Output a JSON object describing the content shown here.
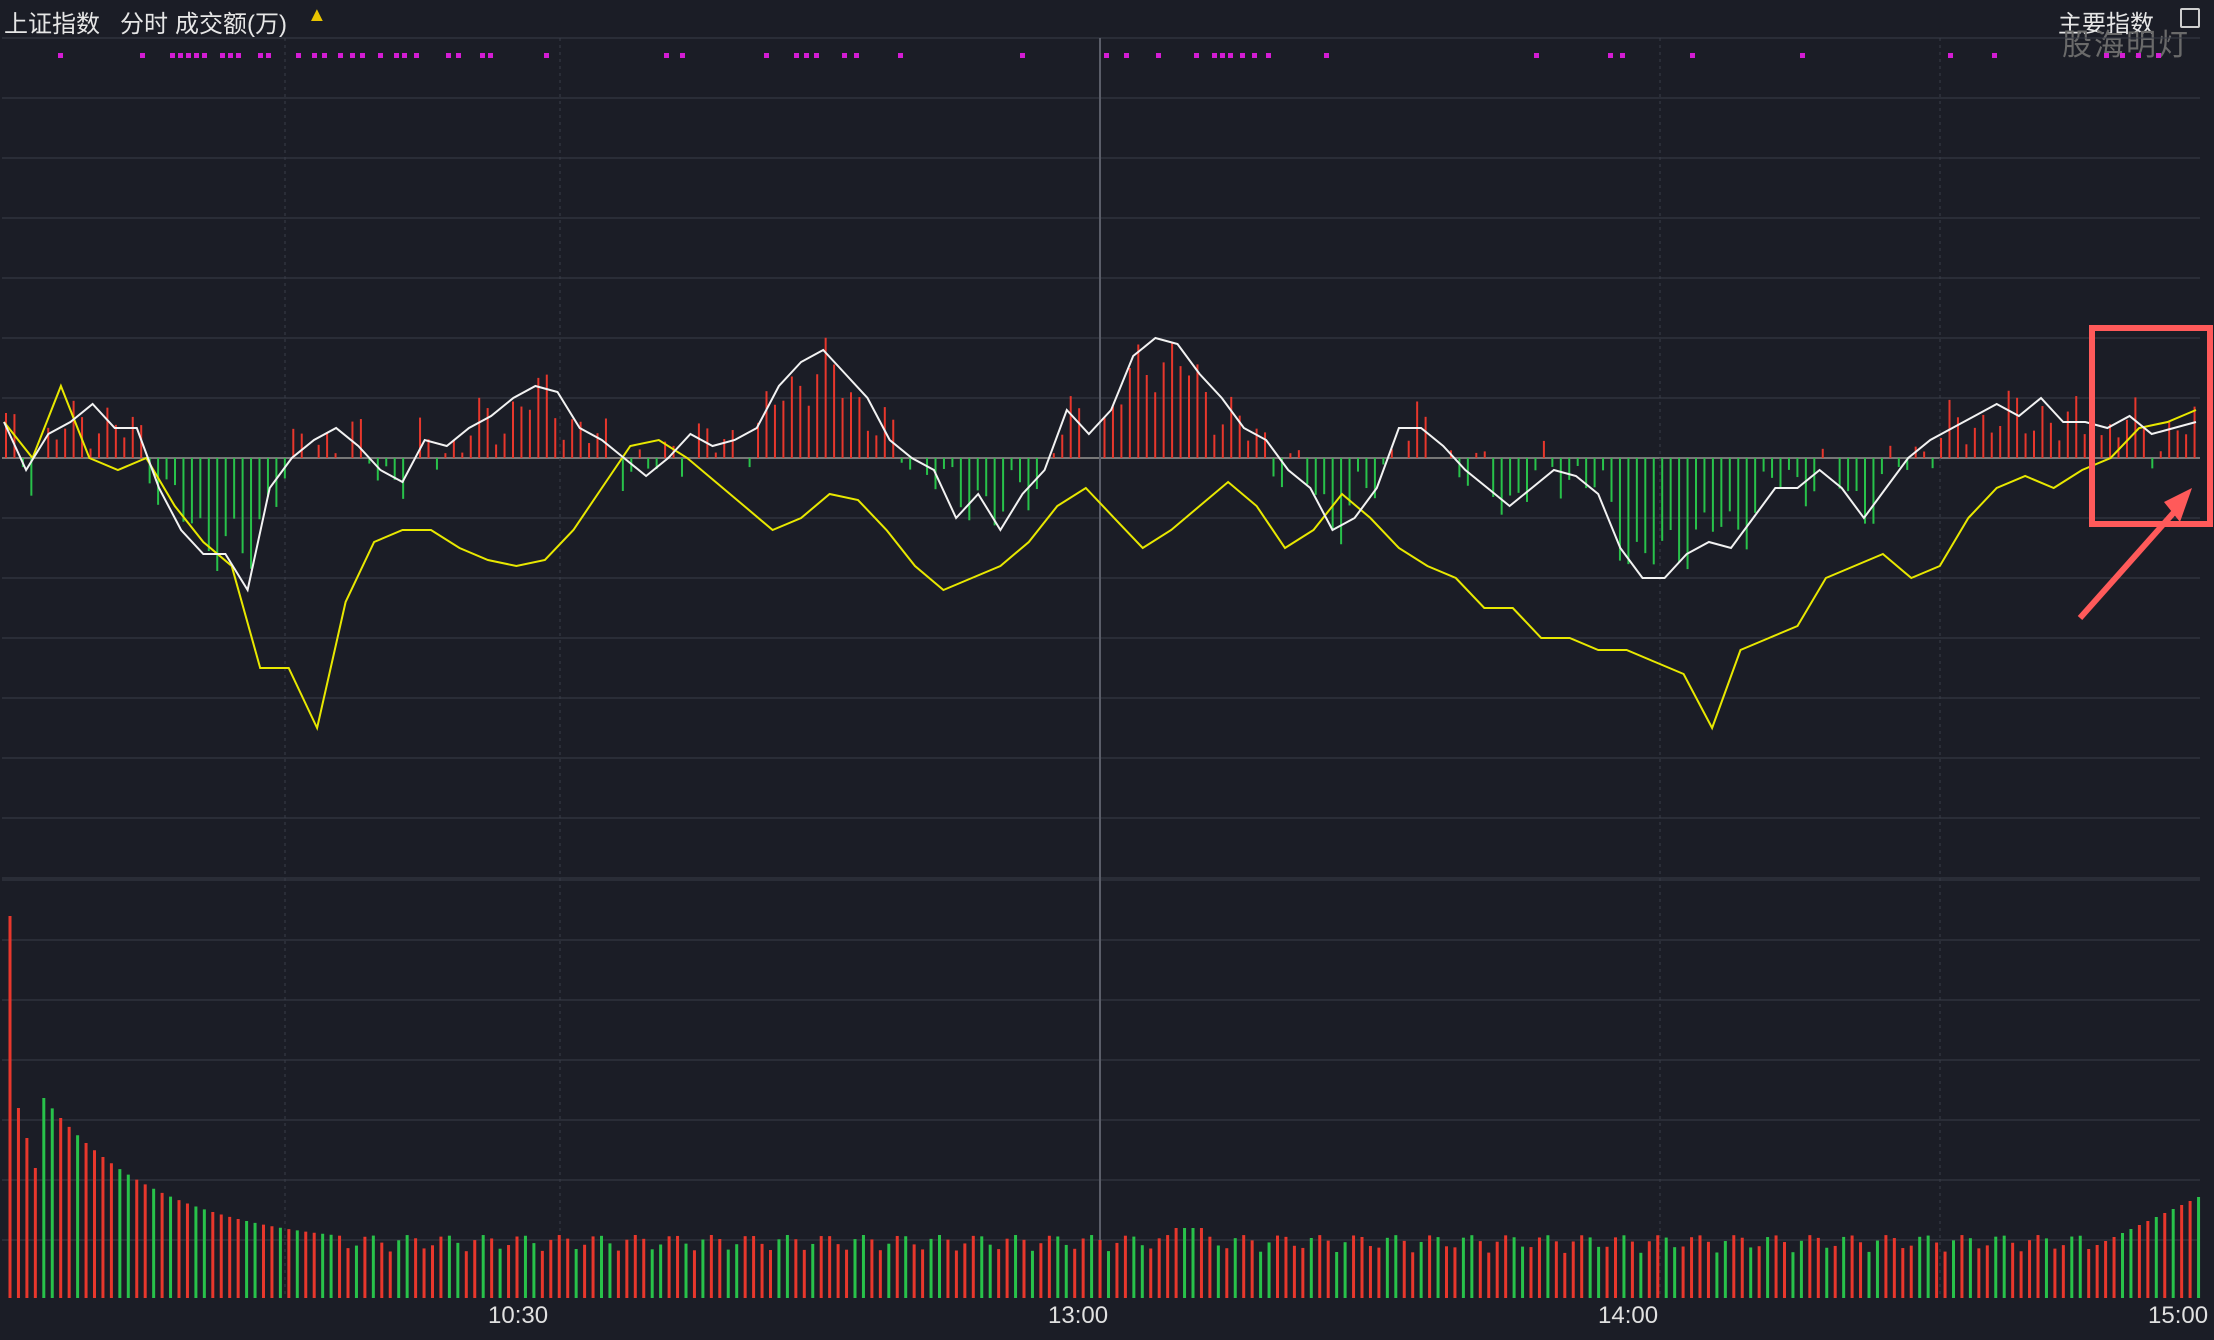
{
  "header": {
    "title": "上证指数",
    "mode": "分时",
    "volume_label": "成交额(万)",
    "toggle_icon": "up-down-arrow-icon",
    "main_index_label": "主要指数",
    "restore_icon": "window-restore-icon",
    "watermark": "股海明灯"
  },
  "colors": {
    "background": "#1b1d26",
    "grid": "#3a3d48",
    "white_line": "#f2f2f2",
    "yellow_line": "#e8e800",
    "up": "#e8372c",
    "down": "#28c24a",
    "dot": "#d41cd4",
    "highlight": "#ff5a5a"
  },
  "chart_data": {
    "type": "line",
    "x_ticks": [
      "10:30",
      "13:00",
      "14:00",
      "15:00"
    ],
    "series": [
      {
        "color": "white",
        "values": [
          0.06,
          -0.02,
          0.04,
          0.06,
          0.09,
          0.05,
          0.05,
          -0.05,
          -0.12,
          -0.16,
          -0.16,
          -0.22,
          -0.05,
          0.0,
          0.03,
          0.05,
          0.02,
          -0.02,
          -0.04,
          0.03,
          0.02,
          0.05,
          0.07,
          0.1,
          0.12,
          0.11,
          0.05,
          0.03,
          0.0,
          -0.03,
          0.0,
          0.04,
          0.02,
          0.03,
          0.05,
          0.12,
          0.16,
          0.18,
          0.14,
          0.1,
          0.03,
          0.0,
          -0.02,
          -0.1,
          -0.06,
          -0.12,
          -0.06,
          -0.02,
          0.08,
          0.04,
          0.08,
          0.17,
          0.2,
          0.19,
          0.14,
          0.1,
          0.05,
          0.03,
          -0.02,
          -0.05,
          -0.12,
          -0.1,
          -0.05,
          0.05,
          0.05,
          0.02,
          -0.02,
          -0.05,
          -0.08,
          -0.05,
          -0.02,
          -0.03,
          -0.06,
          -0.15,
          -0.2,
          -0.2,
          -0.16,
          -0.14,
          -0.15,
          -0.1,
          -0.05,
          -0.05,
          -0.02,
          -0.05,
          -0.1,
          -0.05,
          0.0,
          0.03,
          0.05,
          0.07,
          0.09,
          0.07,
          0.1,
          0.06,
          0.06,
          0.05,
          0.07,
          0.04,
          0.05,
          0.06
        ],
        "note_units": "percent"
      },
      {
        "color": "yellow",
        "values": [
          0.06,
          0.0,
          0.12,
          0.0,
          -0.02,
          0.0,
          -0.08,
          -0.14,
          -0.18,
          -0.35,
          -0.35,
          -0.45,
          -0.24,
          -0.14,
          -0.12,
          -0.12,
          -0.15,
          -0.17,
          -0.18,
          -0.17,
          -0.12,
          -0.05,
          0.02,
          0.03,
          0.0,
          -0.04,
          -0.08,
          -0.12,
          -0.1,
          -0.06,
          -0.07,
          -0.12,
          -0.18,
          -0.22,
          -0.2,
          -0.18,
          -0.14,
          -0.08,
          -0.05,
          -0.1,
          -0.15,
          -0.12,
          -0.08,
          -0.04,
          -0.08,
          -0.15,
          -0.12,
          -0.06,
          -0.1,
          -0.15,
          -0.18,
          -0.2,
          -0.25,
          -0.25,
          -0.3,
          -0.3,
          -0.32,
          -0.32,
          -0.34,
          -0.36,
          -0.45,
          -0.32,
          -0.3,
          -0.28,
          -0.2,
          -0.18,
          -0.16,
          -0.2,
          -0.18,
          -0.1,
          -0.05,
          -0.03,
          -0.05,
          -0.02,
          0.0,
          0.05,
          0.06,
          0.08
        ]
      }
    ],
    "bottom_panel": "volume bars"
  }
}
